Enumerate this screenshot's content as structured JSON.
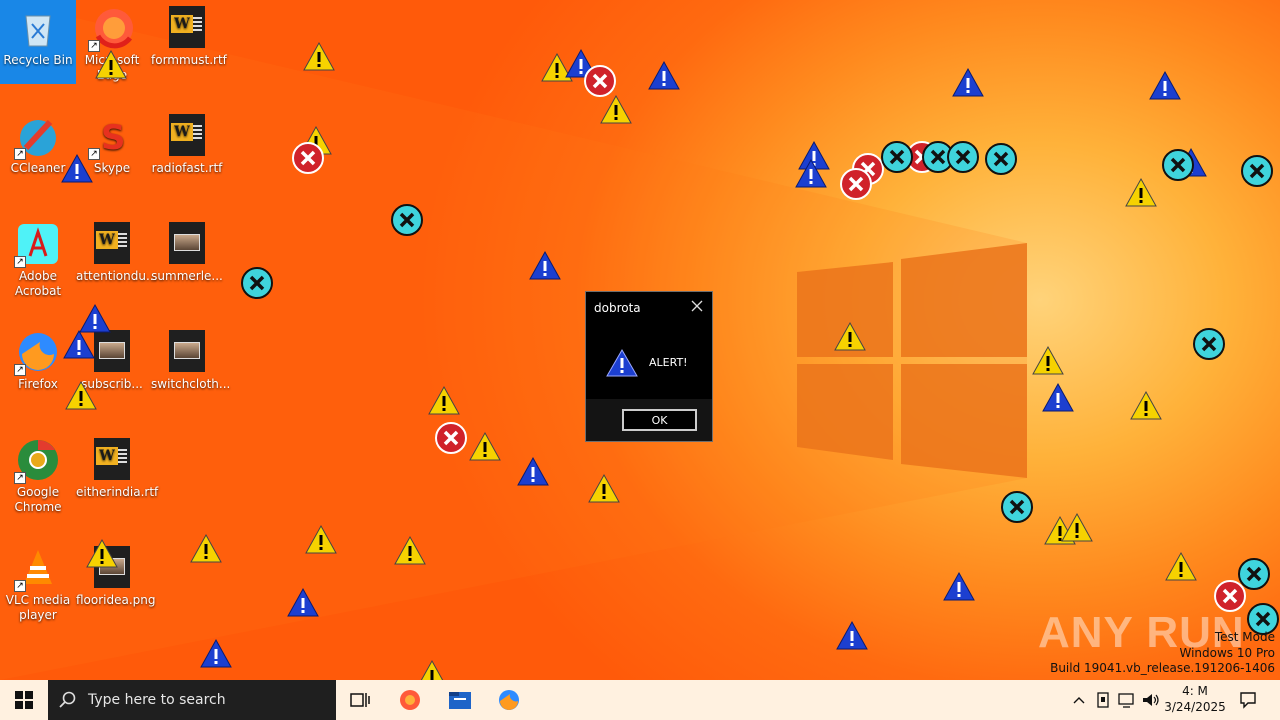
{
  "desktop_icons": [
    {
      "label": "Recycle Bin",
      "icon": "recycle-bin-icon"
    },
    {
      "label": "Microsoft Edge",
      "icon": "edge-icon"
    },
    {
      "label": "formmust.rtf",
      "icon": "word-document-icon"
    },
    {
      "label": "CCleaner",
      "icon": "ccleaner-icon"
    },
    {
      "label": "Skype",
      "icon": "skype-icon"
    },
    {
      "label": "radiofast.rtf",
      "icon": "word-document-icon"
    },
    {
      "label": "Adobe Acrobat",
      "icon": "acrobat-icon"
    },
    {
      "label": "attentiondu...",
      "icon": "word-document-icon"
    },
    {
      "label": "summerle...",
      "icon": "image-file-icon"
    },
    {
      "label": "Firefox",
      "icon": "firefox-icon"
    },
    {
      "label": "subscrib...",
      "icon": "image-file-icon"
    },
    {
      "label": "switchcloth...",
      "icon": "image-file-icon"
    },
    {
      "label": "Google Chrome",
      "icon": "chrome-icon"
    },
    {
      "label": "eitherindia.rtf",
      "icon": "word-document-icon"
    },
    {
      "label": "VLC media player",
      "icon": "vlc-icon"
    },
    {
      "label": "flooridea.png",
      "icon": "image-file-icon"
    }
  ],
  "dialog": {
    "title": "dobrota",
    "message": "ALERT!",
    "ok_label": "OK",
    "icon": "warning-icon"
  },
  "watermark": "ANY RUN",
  "windows_info": {
    "line1": "Test Mode",
    "line2": "Windows 10 Pro",
    "line3": "Build 19041.vb_release.191206-1406"
  },
  "taskbar": {
    "search_placeholder": "Type here to search",
    "clock_time": "4:  M",
    "clock_date": "3/24/2025"
  },
  "colors": {
    "wallpaper_accent": "#ff6a10",
    "selection": "#0a8cff",
    "dialog_bg": "#000000"
  }
}
